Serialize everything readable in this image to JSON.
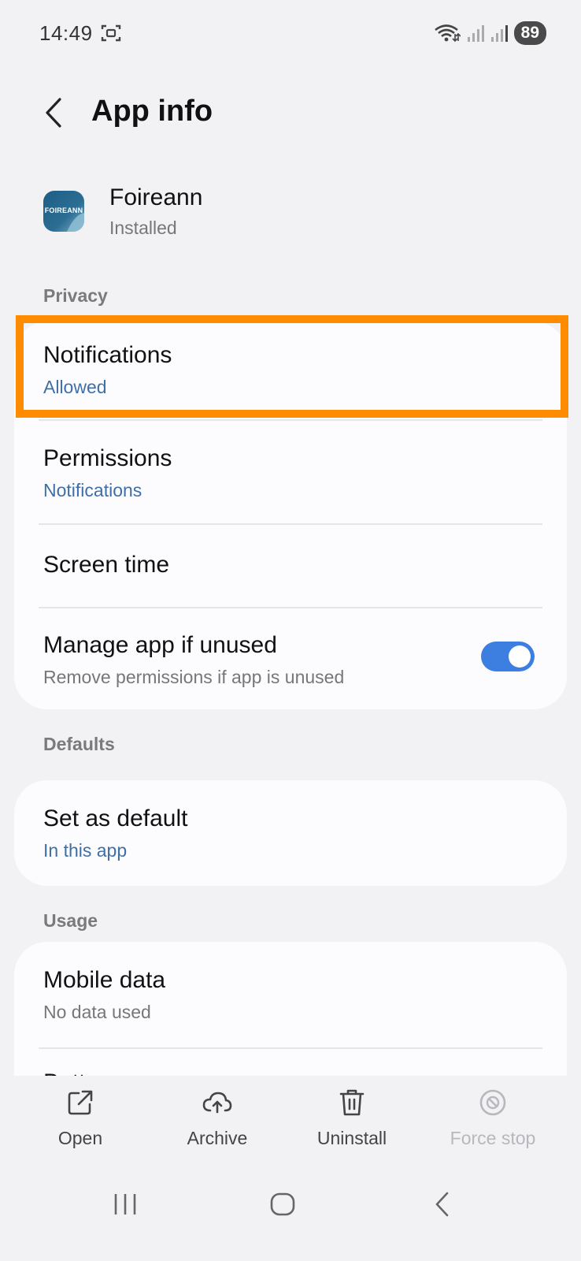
{
  "status_bar": {
    "time": "14:49",
    "battery": "89"
  },
  "header": {
    "title": "App info"
  },
  "app": {
    "icon_text": "FOIREANN",
    "name": "Foireann",
    "status": "Installed"
  },
  "sections": {
    "privacy_label": "Privacy",
    "defaults_label": "Defaults",
    "usage_label": "Usage"
  },
  "privacy": {
    "notifications": {
      "title": "Notifications",
      "sub": "Allowed"
    },
    "permissions": {
      "title": "Permissions",
      "sub": "Notifications"
    },
    "screen_time": {
      "title": "Screen time"
    },
    "manage_unused": {
      "title": "Manage app if unused",
      "sub": "Remove permissions if app is unused",
      "enabled": true
    }
  },
  "defaults": {
    "set_default": {
      "title": "Set as default",
      "sub": "In this app"
    }
  },
  "usage": {
    "mobile_data": {
      "title": "Mobile data",
      "sub": "No data used"
    },
    "battery": {
      "title": "Battery"
    }
  },
  "actions": {
    "open": "Open",
    "archive": "Archive",
    "uninstall": "Uninstall",
    "force_stop": "Force stop"
  },
  "colors": {
    "highlight": "#ff8c00",
    "accent_blue": "#3f6fa6",
    "toggle_on": "#3d7fe0"
  }
}
